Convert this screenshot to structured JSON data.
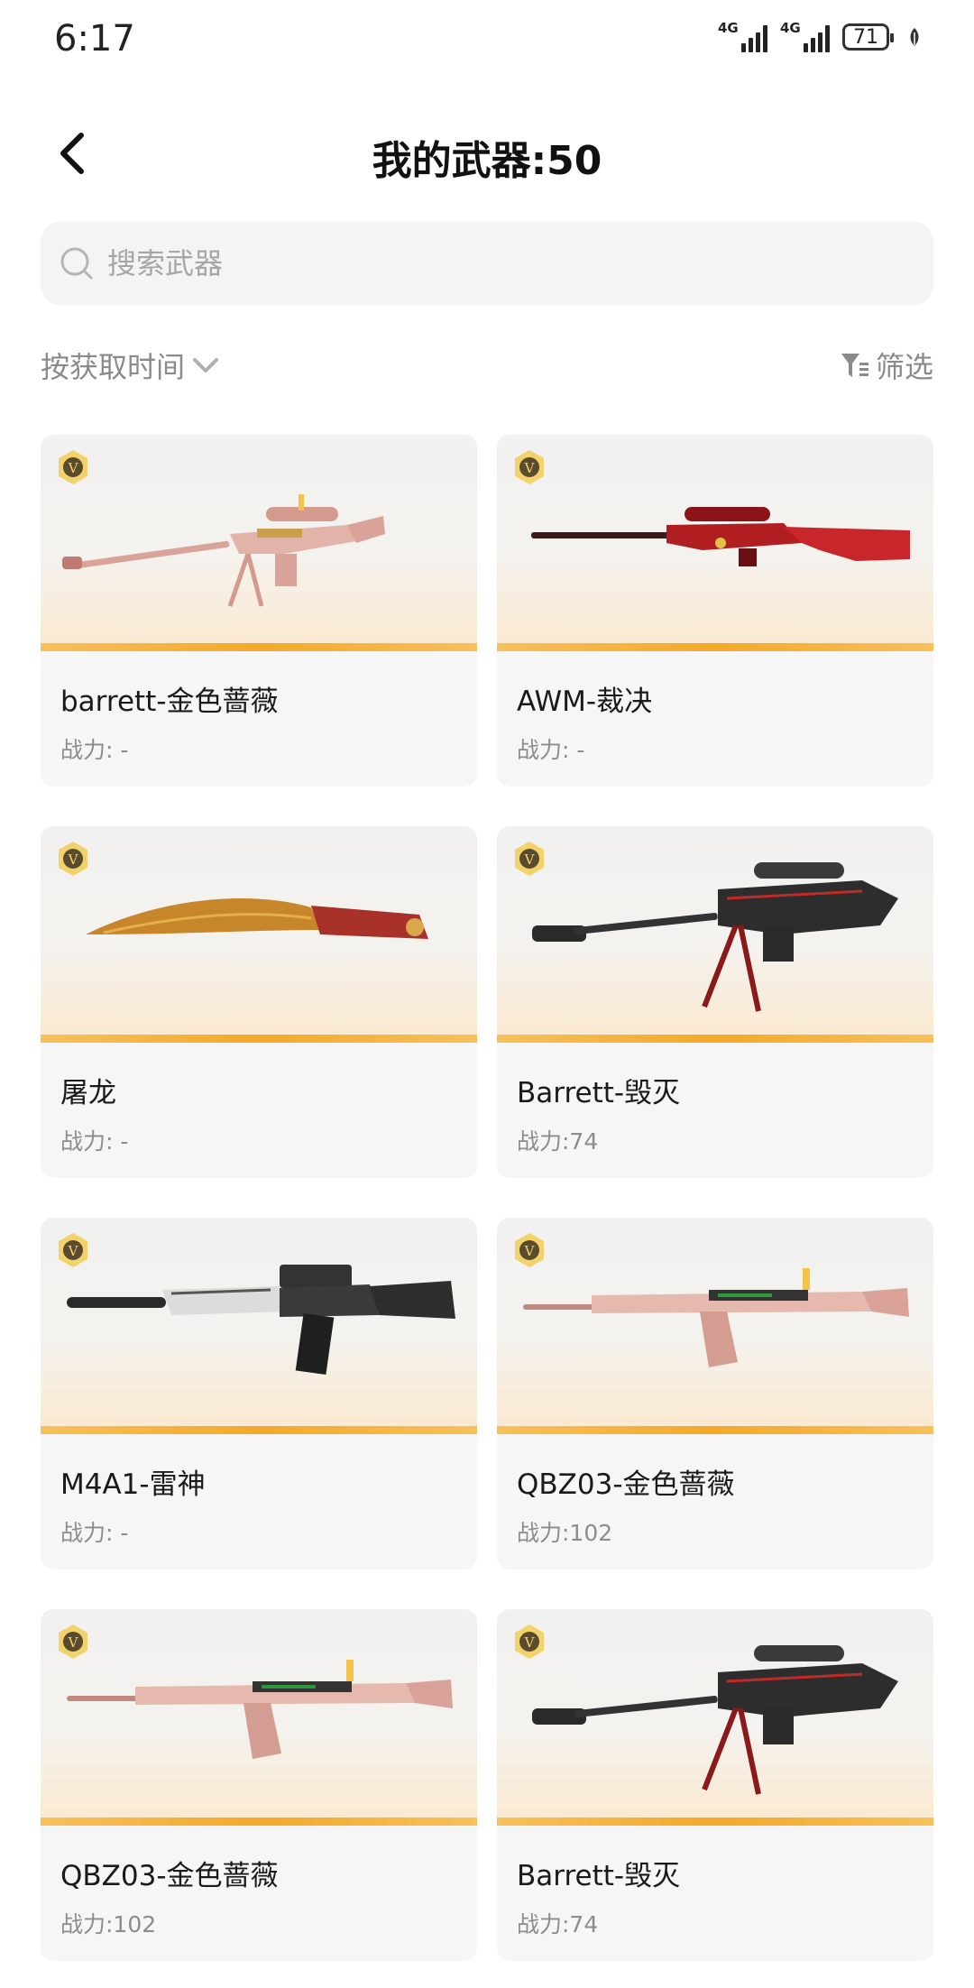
{
  "status_bar": {
    "time": "6:17",
    "signal1": "4G",
    "signal2": "4G",
    "battery": "71"
  },
  "header": {
    "title": "我的武器:50"
  },
  "search": {
    "placeholder": "搜索武器"
  },
  "toolbar": {
    "sort_label": "按获取时间",
    "filter_label": "筛选"
  },
  "weapons": [
    {
      "name": "barrett-金色蔷薇",
      "power": "战力: -",
      "icon": "sniper-rifle-pink"
    },
    {
      "name": "AWM-裁决",
      "power": "战力: -",
      "icon": "sniper-rifle-red"
    },
    {
      "name": "屠龙",
      "power": "战力: -",
      "icon": "machete-knife"
    },
    {
      "name": "Barrett-毁灭",
      "power": "战力:74",
      "icon": "sniper-rifle-black"
    },
    {
      "name": "M4A1-雷神",
      "power": "战力: -",
      "icon": "assault-rifle-black"
    },
    {
      "name": "QBZ03-金色蔷薇",
      "power": "战力:102",
      "icon": "assault-rifle-pink"
    },
    {
      "name": "QBZ03-金色蔷薇",
      "power": "战力:102",
      "icon": "assault-rifle-pink"
    },
    {
      "name": "Barrett-毁灭",
      "power": "战力:74",
      "icon": "sniper-rifle-black"
    }
  ],
  "colors": {
    "accent_strip": "#f3a92a",
    "card_bg": "#f6f6f6",
    "muted_text": "#8c8c8c"
  }
}
